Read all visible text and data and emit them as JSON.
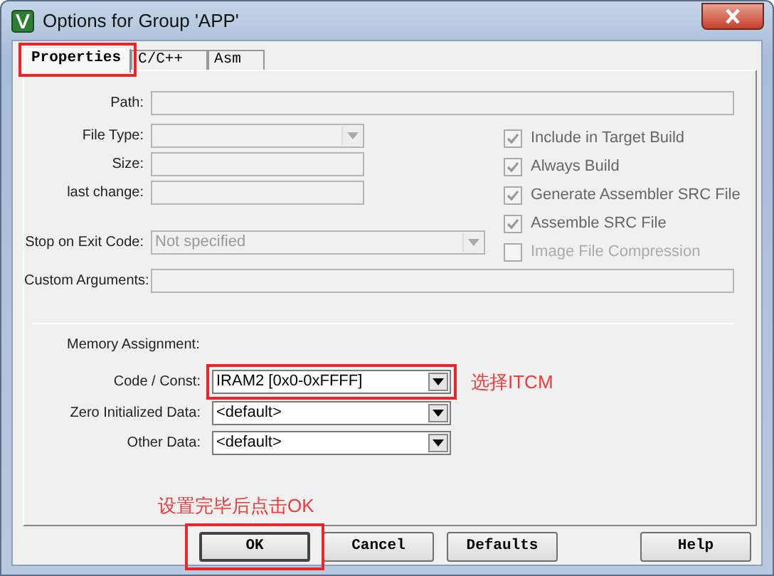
{
  "window": {
    "title": "Options for Group 'APP'"
  },
  "tabs": [
    {
      "label": "Properties",
      "selected": true,
      "highlighted": true
    },
    {
      "label": "C/C++",
      "selected": false,
      "highlighted": false
    },
    {
      "label": "Asm",
      "selected": false,
      "highlighted": false
    }
  ],
  "properties": {
    "path": {
      "label": "Path:",
      "disabled": true
    },
    "left_fields": [
      {
        "label": "File Type:",
        "kind": "combo",
        "disabled": true
      },
      {
        "label": "Size:",
        "kind": "text",
        "disabled": true
      },
      {
        "label": "last change:",
        "kind": "text",
        "disabled": true
      },
      {
        "label": "Stop on Exit Code:",
        "kind": "combo",
        "disabled": true,
        "value": "Not specified"
      }
    ],
    "checkboxes": [
      {
        "label": "Include in Target Build",
        "checked": true,
        "disabled": true
      },
      {
        "label": "Always Build",
        "checked": true,
        "disabled": true
      },
      {
        "label": "Generate Assembler SRC File",
        "checked": true,
        "disabled": true
      },
      {
        "label": "Assemble SRC File",
        "checked": true,
        "disabled": true
      },
      {
        "label": "Image File Compression",
        "checked": false,
        "disabled": true
      }
    ],
    "custom_arguments": {
      "label": "Custom Arguments:",
      "disabled": true
    }
  },
  "memory_assignment": {
    "heading": "Memory Assignment:",
    "fields": [
      {
        "label": "Code / Const:",
        "value": "IRAM2 [0x0-0xFFFF]",
        "highlighted": true
      },
      {
        "label": "Zero Initialized Data:",
        "value": "<default>",
        "highlighted": false
      },
      {
        "label": "Other Data:",
        "value": "<default>",
        "highlighted": false
      }
    ]
  },
  "buttons": [
    {
      "label": "OK",
      "default": true,
      "highlighted": true
    },
    {
      "label": "Cancel",
      "default": false,
      "highlighted": false
    },
    {
      "label": "Defaults",
      "default": false,
      "highlighted": false
    },
    {
      "label": "Help",
      "default": false,
      "highlighted": false
    }
  ],
  "annotations": [
    "选择ITCM",
    "设置完毕后点击OK"
  ]
}
